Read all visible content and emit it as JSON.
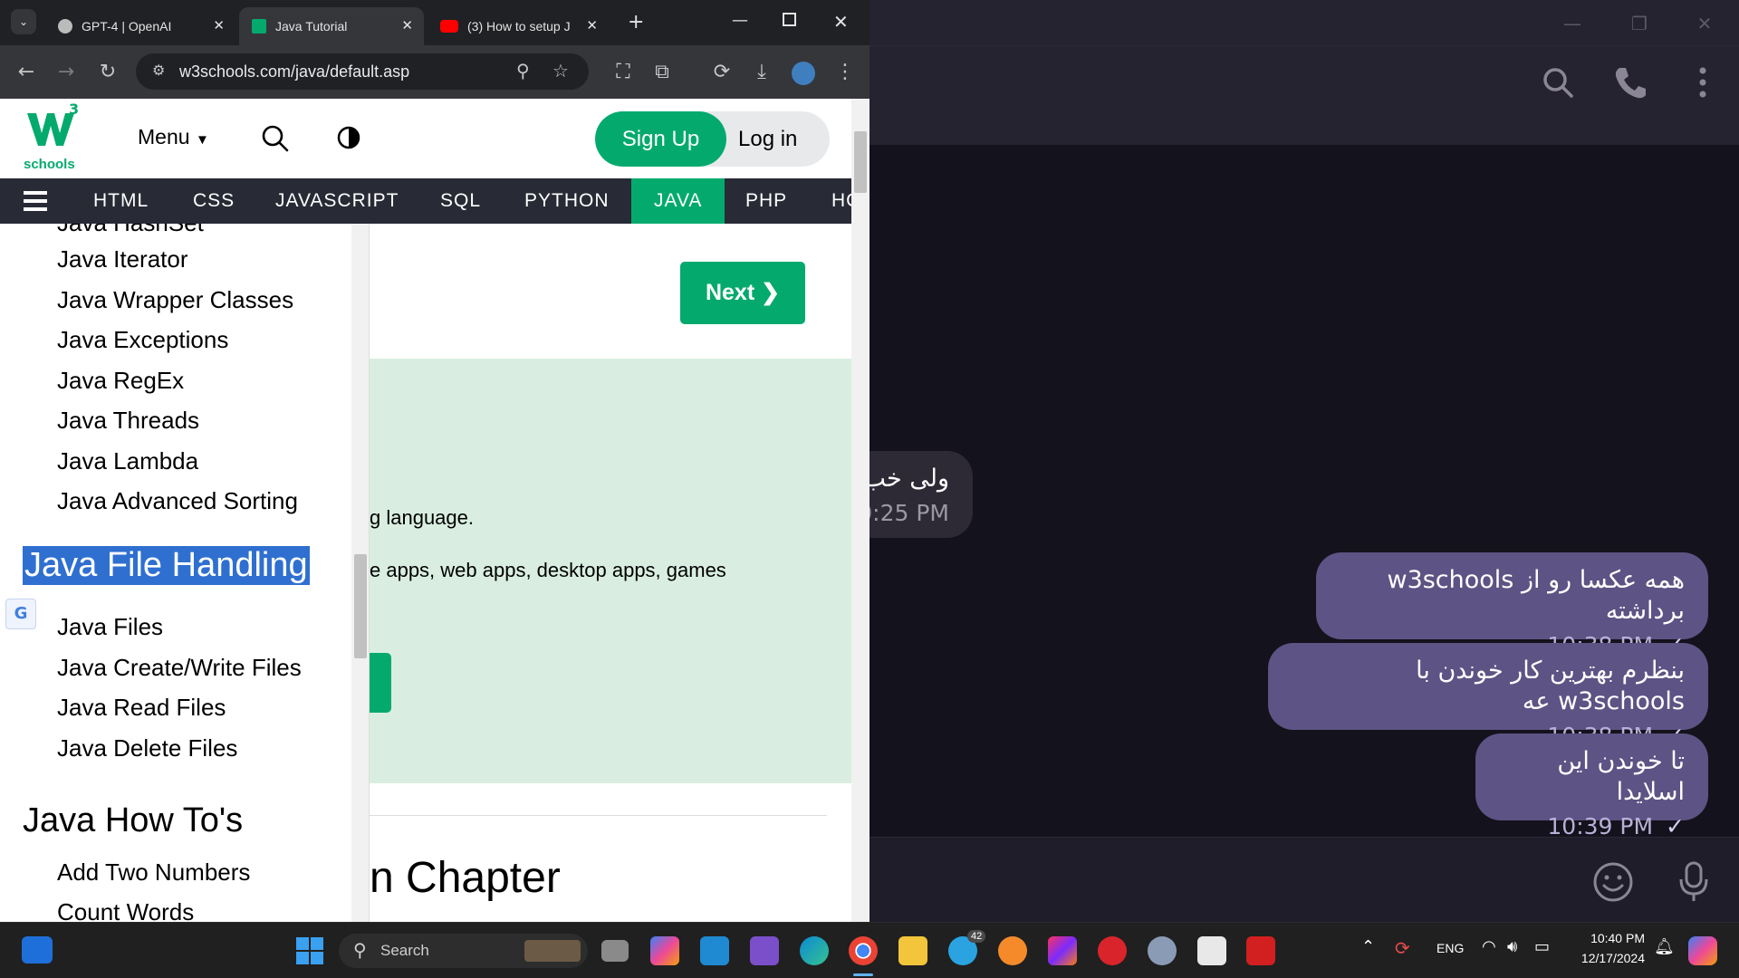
{
  "browser": {
    "tabs": [
      {
        "title": "GPT-4 | OpenAI",
        "active": false
      },
      {
        "title": "Java Tutorial",
        "active": true
      },
      {
        "title": "(3) How to setup J",
        "active": false
      }
    ],
    "url": "w3schools.com/java/default.asp"
  },
  "w3": {
    "logo_text": "schools",
    "logo_sup": "3",
    "menu_label": "Menu",
    "signup_label": "Sign Up",
    "login_label": "Log in",
    "nav": [
      "HTML",
      "CSS",
      "JAVASCRIPT",
      "SQL",
      "PYTHON",
      "JAVA",
      "PHP",
      "HC"
    ],
    "active_nav": "JAVA",
    "sidebar": {
      "partial_top": "Java HashSet",
      "items_1": [
        "Java Iterator",
        "Java Wrapper Classes",
        "Java Exceptions",
        "Java RegEx",
        "Java Threads",
        "Java Lambda",
        "Java Advanced Sorting"
      ],
      "heading_1": "Java File Handling",
      "items_2": [
        "Java Files",
        "Java Create/Write Files",
        "Java Read Files",
        "Java Delete Files"
      ],
      "heading_2": "Java How To's",
      "items_3": [
        "Add Two Numbers",
        "Count Words"
      ]
    },
    "main": {
      "next_label": "Next ❯",
      "line1": "g language.",
      "line2": "e apps, web apps, desktop apps, games",
      "chapter_partial": "n Chapter"
    }
  },
  "telegram": {
    "messages": [
      {
        "text": "ولی خب",
        "time": "0:25 PM",
        "outgoing": false
      },
      {
        "text": "همه عکسا رو از w3schools برداشته",
        "time": "10:38 PM",
        "outgoing": true
      },
      {
        "text": "بنظرم بهترین کار خوندن با w3schools عه",
        "time": "10:38 PM",
        "outgoing": true
      },
      {
        "text": "تا خوندن این اسلایدا",
        "time": "10:39 PM",
        "outgoing": true
      }
    ]
  },
  "taskbar": {
    "search_label": "Search",
    "telegram_badge": "42",
    "lang": "ENG",
    "time": "10:40 PM",
    "date": "12/17/2024"
  }
}
